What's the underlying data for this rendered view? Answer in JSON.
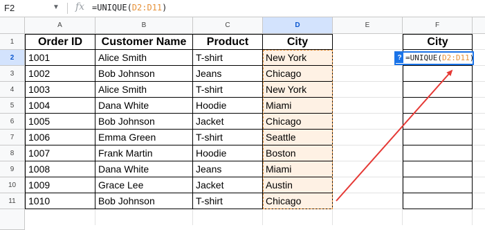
{
  "formula_bar": {
    "name_box": "F2",
    "fx_label": "fx",
    "formula_prefix": "=UNIQUE(",
    "formula_range": "D2:D11",
    "formula_suffix": ")"
  },
  "columns": [
    "A",
    "B",
    "C",
    "D",
    "E",
    "F"
  ],
  "rows": [
    "1",
    "2",
    "3",
    "4",
    "5",
    "6",
    "7",
    "8",
    "9",
    "10",
    "11"
  ],
  "table": {
    "headers": [
      "Order ID",
      "Customer Name",
      "Product",
      "City"
    ],
    "data": [
      [
        "1001",
        "Alice Smith",
        "T-shirt",
        "New York"
      ],
      [
        "1002",
        "Bob Johnson",
        "Jeans",
        "Chicago"
      ],
      [
        "1003",
        "Alice Smith",
        "T-shirt",
        "New York"
      ],
      [
        "1004",
        "Dana White",
        "Hoodie",
        "Miami"
      ],
      [
        "1005",
        "Bob Johnson",
        "Jacket",
        "Chicago"
      ],
      [
        "1006",
        "Emma Green",
        "T-shirt",
        "Seattle"
      ],
      [
        "1007",
        "Frank Martin",
        "Hoodie",
        "Boston"
      ],
      [
        "1008",
        "Dana White",
        "Jeans",
        "Miami"
      ],
      [
        "1009",
        "Grace Lee",
        "Jacket",
        "Austin"
      ],
      [
        "1010",
        "Bob Johnson",
        "T-shirt",
        "Chicago"
      ]
    ]
  },
  "output": {
    "header": "City",
    "editor_badge": "?",
    "editor_prefix": "=UNIQUE(",
    "editor_range": "D2:D11",
    "editor_suffix": ")"
  },
  "colors": {
    "range_highlight": "#e69138",
    "range_fill": "#fef1e4",
    "arrow": "#e53935",
    "selection": "#1a73e8"
  }
}
